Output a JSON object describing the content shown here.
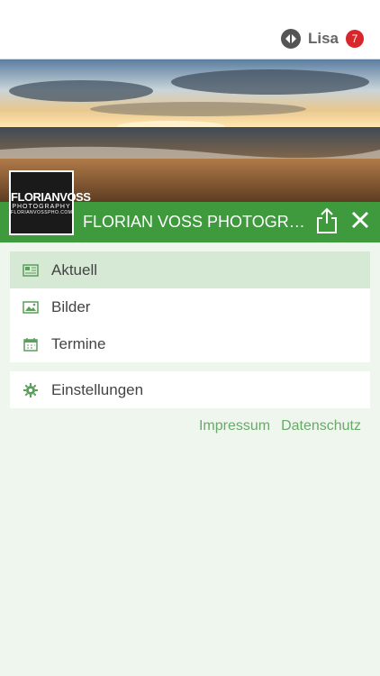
{
  "user": {
    "name": "Lisa",
    "notification_count": "7"
  },
  "header": {
    "title": "FLORIAN VOSS PHOTOGRAPHY",
    "avatar_line1": "FLORIANVOSS",
    "avatar_line2": "PHOTOGRAPHY",
    "avatar_line3": "FLORIANVOSSPHO.COM"
  },
  "menu": {
    "items": [
      {
        "label": "Aktuell",
        "icon": "newspaper-icon",
        "active": true
      },
      {
        "label": "Bilder",
        "icon": "image-icon",
        "active": false
      },
      {
        "label": "Termine",
        "icon": "calendar-icon",
        "active": false
      }
    ],
    "settings": {
      "label": "Einstellungen",
      "icon": "gear-icon"
    }
  },
  "footer": {
    "impressum": "Impressum",
    "datenschutz": "Datenschutz"
  },
  "colors": {
    "accent": "#3e9a3c",
    "background": "#eff6ee",
    "active": "#d6e9d4",
    "badge": "#d9262b"
  }
}
